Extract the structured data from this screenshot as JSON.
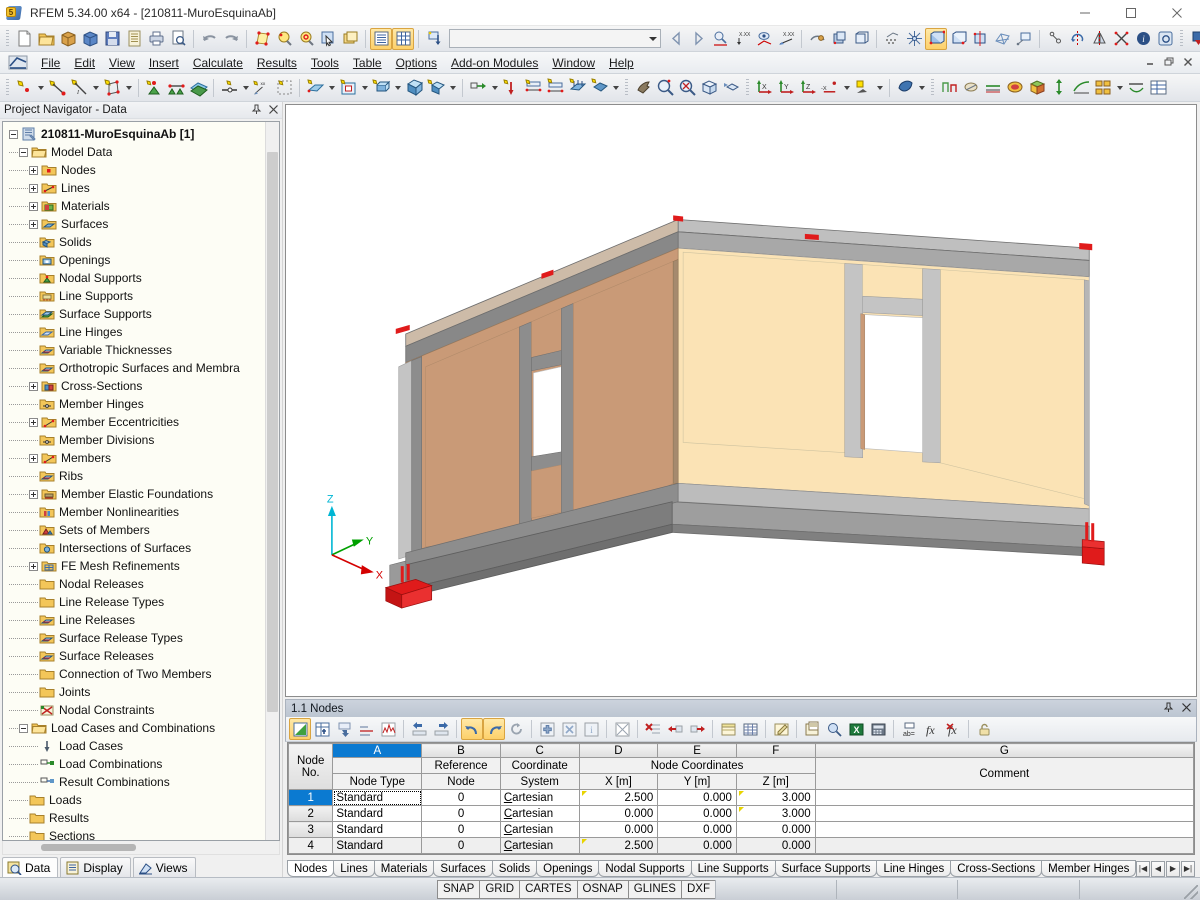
{
  "window": {
    "title": "RFEM 5.34.00 x64 - [210811-MuroEsquinaAb]",
    "app_icon": "rfem-logo-icon",
    "minimize": "—",
    "maximize": "□",
    "close": "✕"
  },
  "menubar": {
    "items": [
      {
        "label": "File"
      },
      {
        "label": "Edit"
      },
      {
        "label": "View"
      },
      {
        "label": "Insert"
      },
      {
        "label": "Calculate"
      },
      {
        "label": "Results"
      },
      {
        "label": "Tools"
      },
      {
        "label": "Table"
      },
      {
        "label": "Options"
      },
      {
        "label": "Add-on Modules"
      },
      {
        "label": "Window"
      },
      {
        "label": "Help"
      }
    ],
    "mdi": {
      "minimize": "–",
      "restore": "❐",
      "close": "✕"
    }
  },
  "toolbar_main": {
    "combo_value": "",
    "combo_placeholder": "",
    "groups": [
      {
        "name": "file",
        "buttons": [
          "new-document-icon",
          "open-folder-icon",
          "open-package-icon",
          "open-project-icon",
          "save-icon",
          "save-all-icon",
          "print-icon",
          "print-preview-icon"
        ]
      },
      {
        "name": "undo",
        "buttons": [
          "undo-icon",
          "redo-icon"
        ]
      },
      {
        "name": "edit",
        "buttons": [
          "edit-model-icon",
          "find-icon",
          "find-target-icon",
          "select-icon",
          "new-window-icon"
        ]
      },
      {
        "name": "table",
        "buttons": [
          "show-table-icon",
          "show-grid-icon"
        ]
      },
      {
        "name": "load",
        "buttons": [
          "load-case-icon"
        ]
      },
      {
        "name": "nav",
        "buttons": [
          "prev-icon",
          "next-icon",
          "zoom-result-icon",
          "value-xx-icon",
          "display-result-icon",
          "value-xx-2-icon"
        ]
      },
      {
        "name": "render",
        "buttons": [
          "render-icon",
          "render-solid-icon",
          "render-wire-icon"
        ]
      },
      {
        "name": "view",
        "buttons": [
          "grid-snap-icon",
          "snap-icon",
          "wire-model-icon",
          "model-front-icon",
          "model-iso-icon",
          "fe-mesh-icon",
          "section-icon"
        ]
      },
      {
        "name": "tools2",
        "buttons": [
          "measure-icon",
          "rotate-icon",
          "mirror-icon",
          "intersect-icon",
          "info-icon",
          "settings-icon"
        ]
      },
      {
        "name": "export",
        "buttons": [
          "export-icon"
        ]
      }
    ]
  },
  "toolbar_model": {
    "groups": [
      {
        "name": "nodes",
        "buttons": [
          "new-node-icon",
          "new-line-icon",
          "new-line-dim-icon",
          "new-polyline-icon"
        ]
      },
      {
        "name": "supports",
        "buttons": [
          "nodal-support-icon",
          "line-support-icon",
          "surface-support-icon"
        ]
      },
      {
        "name": "hinges",
        "buttons": [
          "member-hinge-icon",
          "eccentricity-xx-icon",
          "selection-frame-icon"
        ]
      },
      {
        "name": "surfaces",
        "buttons": [
          "new-surface-icon",
          "new-opening-icon",
          "new-member-icon",
          "new-solid-icon",
          "new-solid-set-icon"
        ]
      },
      {
        "name": "loads",
        "buttons": [
          "load-transfer-icon",
          "nodal-load-icon",
          "line-load-icon",
          "member-load-icon",
          "surface-load-icon",
          "free-load-icon"
        ]
      },
      {
        "name": "view2",
        "buttons": [
          "pan-icon",
          "zoom-in-icon",
          "zoom-out-icon",
          "zoom-box-icon",
          "zoom-previous-icon"
        ]
      },
      {
        "name": "axes",
        "buttons": [
          "view-x-icon",
          "view-y-icon",
          "view-z-icon",
          "view-minus-x-icon",
          "perspective-icon",
          "shading-icon"
        ]
      },
      {
        "name": "results",
        "buttons": [
          "deformation-icon",
          "support-reaction-icon",
          "internal-force-icon",
          "surface-result-icon",
          "solid-result-icon",
          "result-arrow-icon",
          "result-diagram-icon",
          "result-panels-icon",
          "result-values-icon",
          "result-table-icon"
        ]
      }
    ]
  },
  "navigator": {
    "title": "Project Navigator - Data",
    "pin_icon": "pin-icon",
    "close_icon": "close-icon",
    "tree": [
      {
        "label": "210811-MuroEsquinaAb [1]",
        "depth": 0,
        "expander": "minus",
        "icon": "project-icon",
        "bold": true
      },
      {
        "label": "Model Data",
        "depth": 1,
        "expander": "minus",
        "icon": "folder-open-icon",
        "bold": false
      },
      {
        "label": "Nodes",
        "depth": 2,
        "expander": "plus",
        "icon": "node-folder-icon",
        "bold": false
      },
      {
        "label": "Lines",
        "depth": 2,
        "expander": "plus",
        "icon": "line-folder-icon",
        "bold": false
      },
      {
        "label": "Materials",
        "depth": 2,
        "expander": "plus",
        "icon": "material-folder-icon",
        "bold": false
      },
      {
        "label": "Surfaces",
        "depth": 2,
        "expander": "plus",
        "icon": "surface-folder-icon",
        "bold": false
      },
      {
        "label": "Solids",
        "depth": 2,
        "expander": "none",
        "icon": "solid-folder-icon",
        "bold": false
      },
      {
        "label": "Openings",
        "depth": 2,
        "expander": "none",
        "icon": "opening-folder-icon",
        "bold": false
      },
      {
        "label": "Nodal Supports",
        "depth": 2,
        "expander": "none",
        "icon": "nodal-support-folder-icon",
        "bold": false
      },
      {
        "label": "Line Supports",
        "depth": 2,
        "expander": "none",
        "icon": "line-support-folder-icon",
        "bold": false
      },
      {
        "label": "Surface Supports",
        "depth": 2,
        "expander": "none",
        "icon": "surface-support-folder-icon",
        "bold": false
      },
      {
        "label": "Line Hinges",
        "depth": 2,
        "expander": "none",
        "icon": "line-hinge-folder-icon",
        "bold": false
      },
      {
        "label": "Variable Thicknesses",
        "depth": 2,
        "expander": "none",
        "icon": "thickness-folder-icon",
        "bold": false
      },
      {
        "label": "Orthotropic Surfaces and Membra",
        "depth": 2,
        "expander": "none",
        "icon": "ortho-folder-icon",
        "bold": false
      },
      {
        "label": "Cross-Sections",
        "depth": 2,
        "expander": "plus",
        "icon": "cross-section-folder-icon",
        "bold": false
      },
      {
        "label": "Member Hinges",
        "depth": 2,
        "expander": "none",
        "icon": "member-hinge-folder-icon",
        "bold": false
      },
      {
        "label": "Member Eccentricities",
        "depth": 2,
        "expander": "plus",
        "icon": "eccentricity-folder-icon",
        "bold": false
      },
      {
        "label": "Member Divisions",
        "depth": 2,
        "expander": "none",
        "icon": "division-folder-icon",
        "bold": false
      },
      {
        "label": "Members",
        "depth": 2,
        "expander": "plus",
        "icon": "member-folder-icon",
        "bold": false
      },
      {
        "label": "Ribs",
        "depth": 2,
        "expander": "none",
        "icon": "rib-folder-icon",
        "bold": false
      },
      {
        "label": "Member Elastic Foundations",
        "depth": 2,
        "expander": "plus",
        "icon": "foundation-folder-icon",
        "bold": false
      },
      {
        "label": "Member Nonlinearities",
        "depth": 2,
        "expander": "none",
        "icon": "nonlinearity-folder-icon",
        "bold": false
      },
      {
        "label": "Sets of Members",
        "depth": 2,
        "expander": "none",
        "icon": "member-set-folder-icon",
        "bold": false
      },
      {
        "label": "Intersections of Surfaces",
        "depth": 2,
        "expander": "none",
        "icon": "intersection-folder-icon",
        "bold": false
      },
      {
        "label": "FE Mesh Refinements",
        "depth": 2,
        "expander": "plus",
        "icon": "fe-mesh-folder-icon",
        "bold": false
      },
      {
        "label": "Nodal Releases",
        "depth": 2,
        "expander": "none",
        "icon": "folder-icon",
        "bold": false
      },
      {
        "label": "Line Release Types",
        "depth": 2,
        "expander": "none",
        "icon": "folder-icon",
        "bold": false
      },
      {
        "label": "Line Releases",
        "depth": 2,
        "expander": "none",
        "icon": "line-release-folder-icon",
        "bold": false
      },
      {
        "label": "Surface Release Types",
        "depth": 2,
        "expander": "none",
        "icon": "surface-release-folder-icon",
        "bold": false
      },
      {
        "label": "Surface Releases",
        "depth": 2,
        "expander": "none",
        "icon": "surface-release-folder-icon",
        "bold": false
      },
      {
        "label": "Connection of Two Members",
        "depth": 2,
        "expander": "none",
        "icon": "folder-icon",
        "bold": false
      },
      {
        "label": "Joints",
        "depth": 2,
        "expander": "none",
        "icon": "folder-icon",
        "bold": false
      },
      {
        "label": "Nodal Constraints",
        "depth": 2,
        "expander": "none",
        "icon": "nodal-constraint-folder-icon",
        "bold": false
      },
      {
        "label": "Load Cases and Combinations",
        "depth": 1,
        "expander": "minus",
        "icon": "folder-open-icon",
        "bold": false
      },
      {
        "label": "Load Cases",
        "depth": 2,
        "expander": "none",
        "icon": "load-case-icon",
        "bold": false
      },
      {
        "label": "Load Combinations",
        "depth": 2,
        "expander": "none",
        "icon": "load-combination-icon",
        "bold": false
      },
      {
        "label": "Result Combinations",
        "depth": 2,
        "expander": "none",
        "icon": "result-combination-icon",
        "bold": false
      },
      {
        "label": "Loads",
        "depth": 1,
        "expander": "none",
        "icon": "folder-icon",
        "bold": false
      },
      {
        "label": "Results",
        "depth": 1,
        "expander": "none",
        "icon": "folder-icon",
        "bold": false
      },
      {
        "label": "Sections",
        "depth": 1,
        "expander": "none",
        "icon": "folder-icon",
        "bold": false
      }
    ],
    "tabs": [
      {
        "label": "Data",
        "icon": "data-tab-icon",
        "selected": true
      },
      {
        "label": "Display",
        "icon": "display-tab-icon",
        "selected": false
      },
      {
        "label": "Views",
        "icon": "views-tab-icon",
        "selected": false
      }
    ]
  },
  "viewport": {
    "axes": {
      "x": "X",
      "y": "Y",
      "z": "Z"
    },
    "colors": {
      "wall_brown": "#c99a77",
      "wall_cream": "#fbe3b5",
      "concrete_gray": "#a8a8a8",
      "concrete_dark": "#7a7a7a",
      "support_red": "#e01b1b",
      "axis_z": "#00b6d4",
      "axis_y": "#00a000",
      "axis_x": "#d40000",
      "background": "#ffffff"
    }
  },
  "table": {
    "title": "1.1 Nodes",
    "pin_icon": "pin-icon",
    "close_icon": "close-icon",
    "toolbar_buttons": [
      "edit-table-icon",
      "insert-row-icon",
      "move-down-icon",
      "sort-icon",
      "chart-icon",
      "prev-col-icon",
      "next-col-icon",
      "undo-table-icon",
      "redo-table-icon",
      "refresh-icon",
      "add-icon",
      "delete-selection-icon",
      "info-col-icon",
      "clear-icon",
      "delete-row-icon",
      "delete-left-icon",
      "delete-right-icon",
      "table-view-icon",
      "table-grid-icon",
      "edit-cell-icon",
      "print-table-icon",
      "print-preview-table-icon",
      "excel-export-icon",
      "calculator-icon",
      "rename-icon",
      "function-icon",
      "clear-function-icon",
      "lock-icon"
    ],
    "column_letters": [
      "A",
      "B",
      "C",
      "D",
      "E",
      "F",
      "G"
    ],
    "selected_column": "A",
    "row_header": {
      "line1": "Node",
      "line2": "No."
    },
    "group_header": {
      "label": "Node Coordinates",
      "span_cols": [
        "D",
        "E",
        "F"
      ]
    },
    "headers": [
      {
        "letter": "A",
        "line1": "",
        "line2": "Node Type"
      },
      {
        "letter": "B",
        "line1": "Reference",
        "line2": "Node"
      },
      {
        "letter": "C",
        "line1": "Coordinate",
        "line2": "System"
      },
      {
        "letter": "D",
        "line1": "",
        "line2": "X [m]"
      },
      {
        "letter": "E",
        "line1": "",
        "line2": "Y [m]"
      },
      {
        "letter": "F",
        "line1": "",
        "line2": "Z [m]"
      },
      {
        "letter": "G",
        "line1": "",
        "line2": "Comment"
      }
    ],
    "rows": [
      {
        "no": "1",
        "node_type": "Standard",
        "reference_node": "0",
        "coordinate_system": "Cartesian",
        "x": "2.500",
        "y": "0.000",
        "z": "3.000",
        "comment": "",
        "selected": true,
        "x_flag": true,
        "y_flag": false,
        "z_flag": true
      },
      {
        "no": "2",
        "node_type": "Standard",
        "reference_node": "0",
        "coordinate_system": "Cartesian",
        "x": "0.000",
        "y": "0.000",
        "z": "3.000",
        "comment": "",
        "selected": false,
        "x_flag": false,
        "y_flag": false,
        "z_flag": true
      },
      {
        "no": "3",
        "node_type": "Standard",
        "reference_node": "0",
        "coordinate_system": "Cartesian",
        "x": "0.000",
        "y": "0.000",
        "z": "0.000",
        "comment": "",
        "selected": false,
        "x_flag": false,
        "y_flag": false,
        "z_flag": false
      },
      {
        "no": "4",
        "node_type": "Standard",
        "reference_node": "0",
        "coordinate_system": "Cartesian",
        "x": "2.500",
        "y": "0.000",
        "z": "0.000",
        "comment": "",
        "selected": false,
        "x_flag": true,
        "y_flag": false,
        "z_flag": false
      }
    ],
    "sheet_tabs": [
      {
        "label": "Nodes",
        "selected": true
      },
      {
        "label": "Lines",
        "selected": false
      },
      {
        "label": "Materials",
        "selected": false
      },
      {
        "label": "Surfaces",
        "selected": false
      },
      {
        "label": "Solids",
        "selected": false
      },
      {
        "label": "Openings",
        "selected": false
      },
      {
        "label": "Nodal Supports",
        "selected": false
      },
      {
        "label": "Line Supports",
        "selected": false
      },
      {
        "label": "Surface Supports",
        "selected": false
      },
      {
        "label": "Line Hinges",
        "selected": false
      },
      {
        "label": "Cross-Sections",
        "selected": false
      },
      {
        "label": "Member Hinges",
        "selected": false
      }
    ],
    "nav_arrows": [
      "⏮",
      "◀",
      "▶",
      "⏭"
    ]
  },
  "statusbar": {
    "cells": [
      {
        "label": "SNAP",
        "active": false
      },
      {
        "label": "GRID",
        "active": false
      },
      {
        "label": "CARTES",
        "active": false
      },
      {
        "label": "OSNAP",
        "active": false
      },
      {
        "label": "GLINES",
        "active": false
      },
      {
        "label": "DXF",
        "active": false
      }
    ]
  }
}
